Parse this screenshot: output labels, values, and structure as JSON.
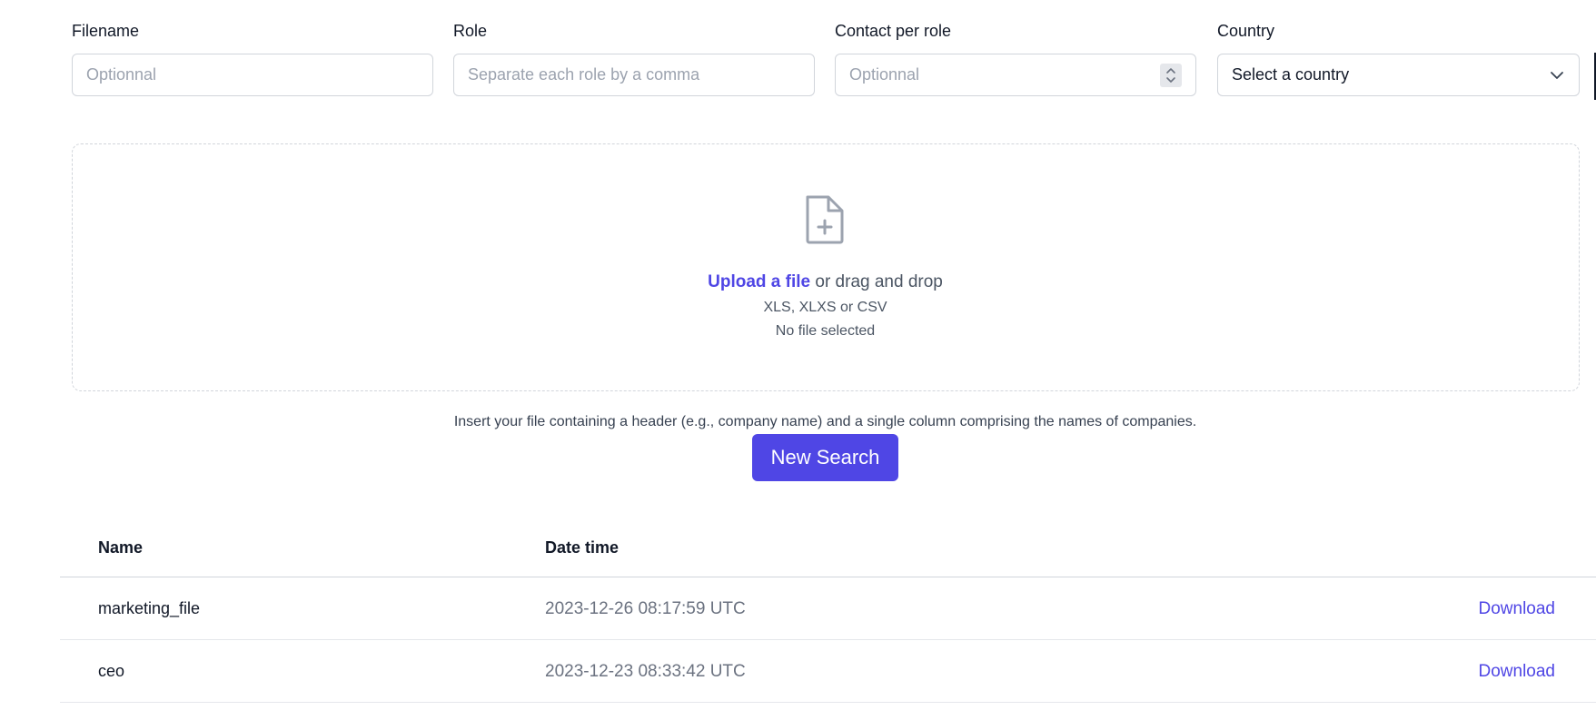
{
  "form": {
    "filename": {
      "label": "Filename",
      "placeholder": "Optionnal",
      "value": ""
    },
    "role": {
      "label": "Role",
      "placeholder": "Separate each role by a comma",
      "value": ""
    },
    "contact_per_role": {
      "label": "Contact per role",
      "placeholder": "Optionnal",
      "value": ""
    },
    "country": {
      "label": "Country",
      "selected": "Select a country"
    }
  },
  "upload": {
    "icon": "document-plus-icon",
    "link_text": "Upload a file",
    "drag_text": " or drag and drop",
    "formats": "XLS, XLXS or CSV",
    "status": "No file selected"
  },
  "instructions": "Insert your file containing a header (e.g., company name) and a single column comprising the names of companies.",
  "new_search_label": "New Search",
  "table": {
    "headers": {
      "name": "Name",
      "datetime": "Date time"
    },
    "rows": [
      {
        "name": "marketing_file",
        "datetime": "2023-12-26 08:17:59 UTC",
        "action": "Download"
      },
      {
        "name": "ceo",
        "datetime": "2023-12-23 08:33:42 UTC",
        "action": "Download"
      }
    ]
  },
  "colors": {
    "accent": "#4f46e5",
    "border": "#d1d5db",
    "muted_text": "#6b7280",
    "placeholder": "#9ca3af"
  }
}
